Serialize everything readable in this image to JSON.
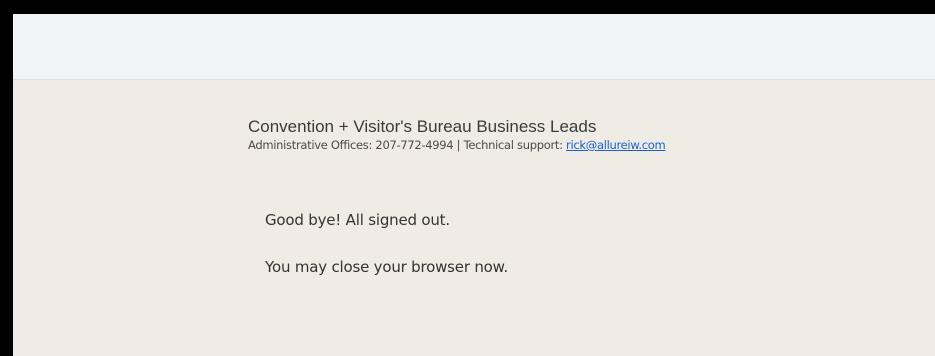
{
  "header": {
    "title": "Convention + Visitor's Bureau Business Leads",
    "offices_label": "Administrative Offices: 207-772-4994",
    "separator": " | ",
    "support_label": "Technical support: ",
    "support_email": "rick@allureiw.com"
  },
  "messages": {
    "goodbye": "Good bye! All signed out.",
    "close_browser": "You may close your browser now."
  },
  "colors": {
    "page_background": "#efece6",
    "top_bar": "#f2f3f5",
    "link": "#1a5fd0",
    "frame": "#000000"
  }
}
